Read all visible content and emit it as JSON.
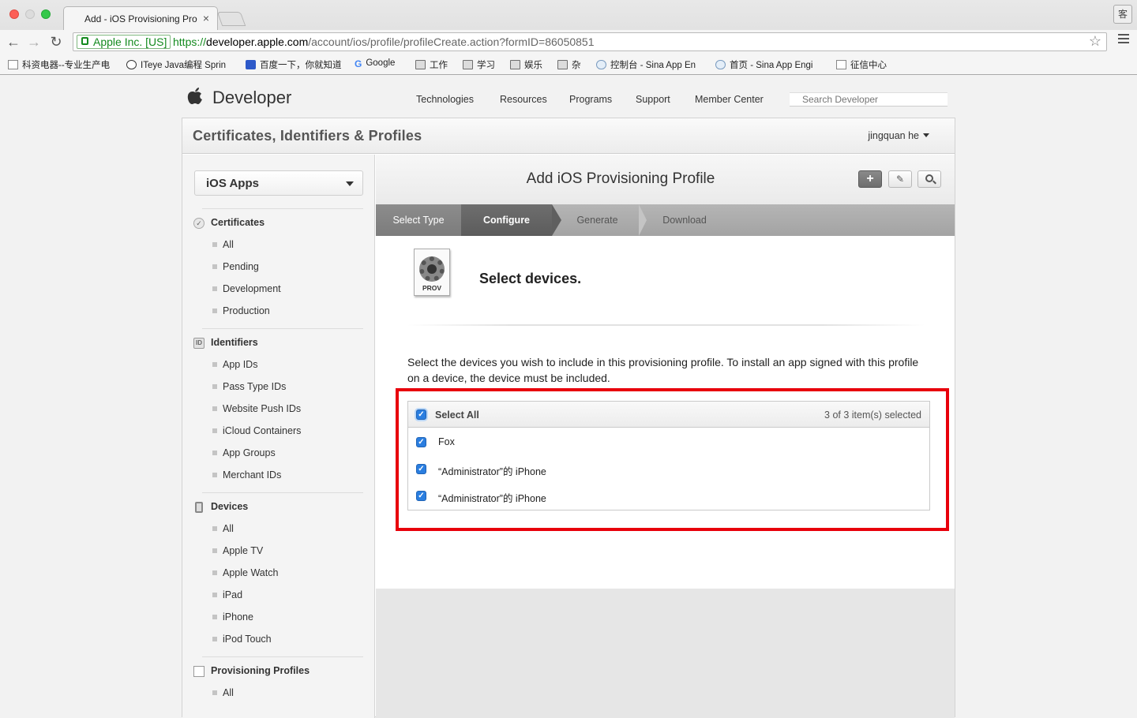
{
  "browser": {
    "tab_title": "Add - iOS Provisioning Pro",
    "profile_label": "客",
    "ev_label": "Apple Inc. [US]",
    "url_scheme": "https://",
    "url_host": "developer.apple.com",
    "url_path": "/account/ios/profile/profileCreate.action?formID=86050851",
    "bookmarks": [
      {
        "label": "科资电器--专业生产电",
        "icon": "page-icon"
      },
      {
        "label": "ITeye Java编程 Sprin",
        "icon": "iteye-icon"
      },
      {
        "label": "百度一下，你就知道",
        "icon": "baidu-icon"
      },
      {
        "label": "Google",
        "icon": "google-icon"
      },
      {
        "label": "工作",
        "icon": "folder-icon"
      },
      {
        "label": "学习",
        "icon": "folder-icon"
      },
      {
        "label": "娱乐",
        "icon": "folder-icon"
      },
      {
        "label": "杂",
        "icon": "folder-icon"
      },
      {
        "label": "控制台 - Sina App En",
        "icon": "cloud-icon"
      },
      {
        "label": "首页 - Sina App Engi",
        "icon": "cloud-icon"
      },
      {
        "label": "征信中心",
        "icon": "page-icon"
      }
    ]
  },
  "site": {
    "brand": "Developer",
    "nav": [
      "Technologies",
      "Resources",
      "Programs",
      "Support",
      "Member Center"
    ],
    "search_placeholder": "Search Developer"
  },
  "panel": {
    "title": "Certificates, Identifiers & Profiles",
    "user": "jingquan he"
  },
  "sidebar": {
    "platform": "iOS Apps",
    "sections": [
      {
        "title": "Certificates",
        "items": [
          "All",
          "Pending",
          "Development",
          "Production"
        ]
      },
      {
        "title": "Identifiers",
        "items": [
          "App IDs",
          "Pass Type IDs",
          "Website Push IDs",
          "iCloud Containers",
          "App Groups",
          "Merchant IDs"
        ]
      },
      {
        "title": "Devices",
        "items": [
          "All",
          "Apple TV",
          "Apple Watch",
          "iPad",
          "iPhone",
          "iPod Touch"
        ]
      },
      {
        "title": "Provisioning Profiles",
        "items": [
          "All"
        ]
      }
    ],
    "identifiers_badge": "ID"
  },
  "main": {
    "title": "Add iOS Provisioning Profile",
    "steps": [
      "Select Type",
      "Configure",
      "Generate",
      "Download"
    ],
    "active_step": "Configure",
    "icon_label": "PROV",
    "heading": "Select devices.",
    "instructions": "Select the devices you wish to include in this provisioning profile. To install an app signed with this profile on a device, the device must be included.",
    "select_all_label": "Select All",
    "selected_count": "3 of 3 item(s) selected",
    "devices": [
      {
        "name": "Fox",
        "checked": true
      },
      {
        "name": "“Administrator”的 iPhone",
        "checked": true
      },
      {
        "name": "“Administrator”的 iPhone",
        "checked": true
      }
    ],
    "highlight_color": "#e8000b"
  }
}
